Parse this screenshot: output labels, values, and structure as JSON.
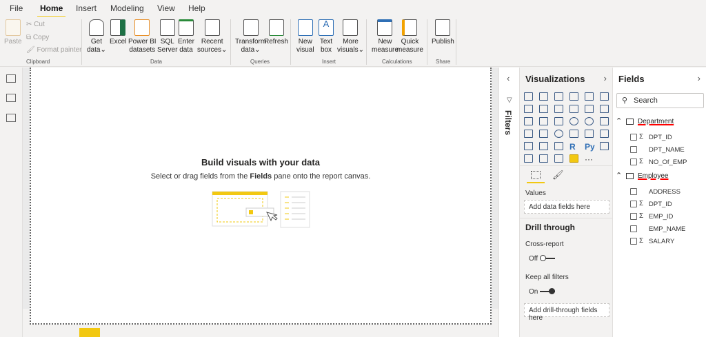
{
  "tabs": [
    "File",
    "Home",
    "Insert",
    "Modeling",
    "View",
    "Help"
  ],
  "clipboard": {
    "paste": "Paste",
    "cut": "Cut",
    "copy": "Copy",
    "format_painter": "Format painter",
    "group": "Clipboard"
  },
  "data_group": {
    "get_data": [
      "Get",
      "data"
    ],
    "excel": "Excel",
    "pbi": [
      "Power BI",
      "datasets"
    ],
    "sql": [
      "SQL",
      "Server"
    ],
    "enter": [
      "Enter",
      "data"
    ],
    "recent": [
      "Recent",
      "sources"
    ],
    "group": "Data"
  },
  "queries": {
    "transform": [
      "Transform",
      "data"
    ],
    "refresh": "Refresh",
    "group": "Queries"
  },
  "insert": {
    "new_visual": [
      "New",
      "visual"
    ],
    "text_box": [
      "Text",
      "box"
    ],
    "more": [
      "More",
      "visuals"
    ],
    "group": "Insert"
  },
  "calc": {
    "new_measure": [
      "New",
      "measure"
    ],
    "quick": [
      "Quick",
      "measure"
    ],
    "group": "Calculations"
  },
  "share": {
    "publish": "Publish",
    "group": "Share"
  },
  "canvas": {
    "title": "Build visuals with your data",
    "sub_pre": "Select or drag fields from the ",
    "sub_bold": "Fields",
    "sub_post": " pane onto the report canvas."
  },
  "filters": {
    "label": "Filters"
  },
  "viz": {
    "title": "Visualizations",
    "values_label": "Values",
    "values_placeholder": "Add data fields here",
    "drill_title": "Drill through",
    "cross_report": "Cross-report",
    "off": "Off",
    "keep_filters": "Keep all filters",
    "on": "On",
    "drill_placeholder": "Add drill-through fields here",
    "more": "···",
    "r": "R",
    "py": "Py"
  },
  "fields": {
    "title": "Fields",
    "search_placeholder": "Search",
    "tables": [
      {
        "name": "Department",
        "fields": [
          {
            "name": "DPT_ID",
            "sigma": true
          },
          {
            "name": "DPT_NAME",
            "sigma": false
          },
          {
            "name": "NO_Of_EMP",
            "sigma": true
          }
        ]
      },
      {
        "name": "Employee",
        "fields": [
          {
            "name": "ADDRESS",
            "sigma": false
          },
          {
            "name": "DPT_ID",
            "sigma": true
          },
          {
            "name": "EMP_ID",
            "sigma": true
          },
          {
            "name": "EMP_NAME",
            "sigma": false
          },
          {
            "name": "SALARY",
            "sigma": true
          }
        ]
      }
    ]
  },
  "colors": {
    "accent": "#f2c811"
  }
}
